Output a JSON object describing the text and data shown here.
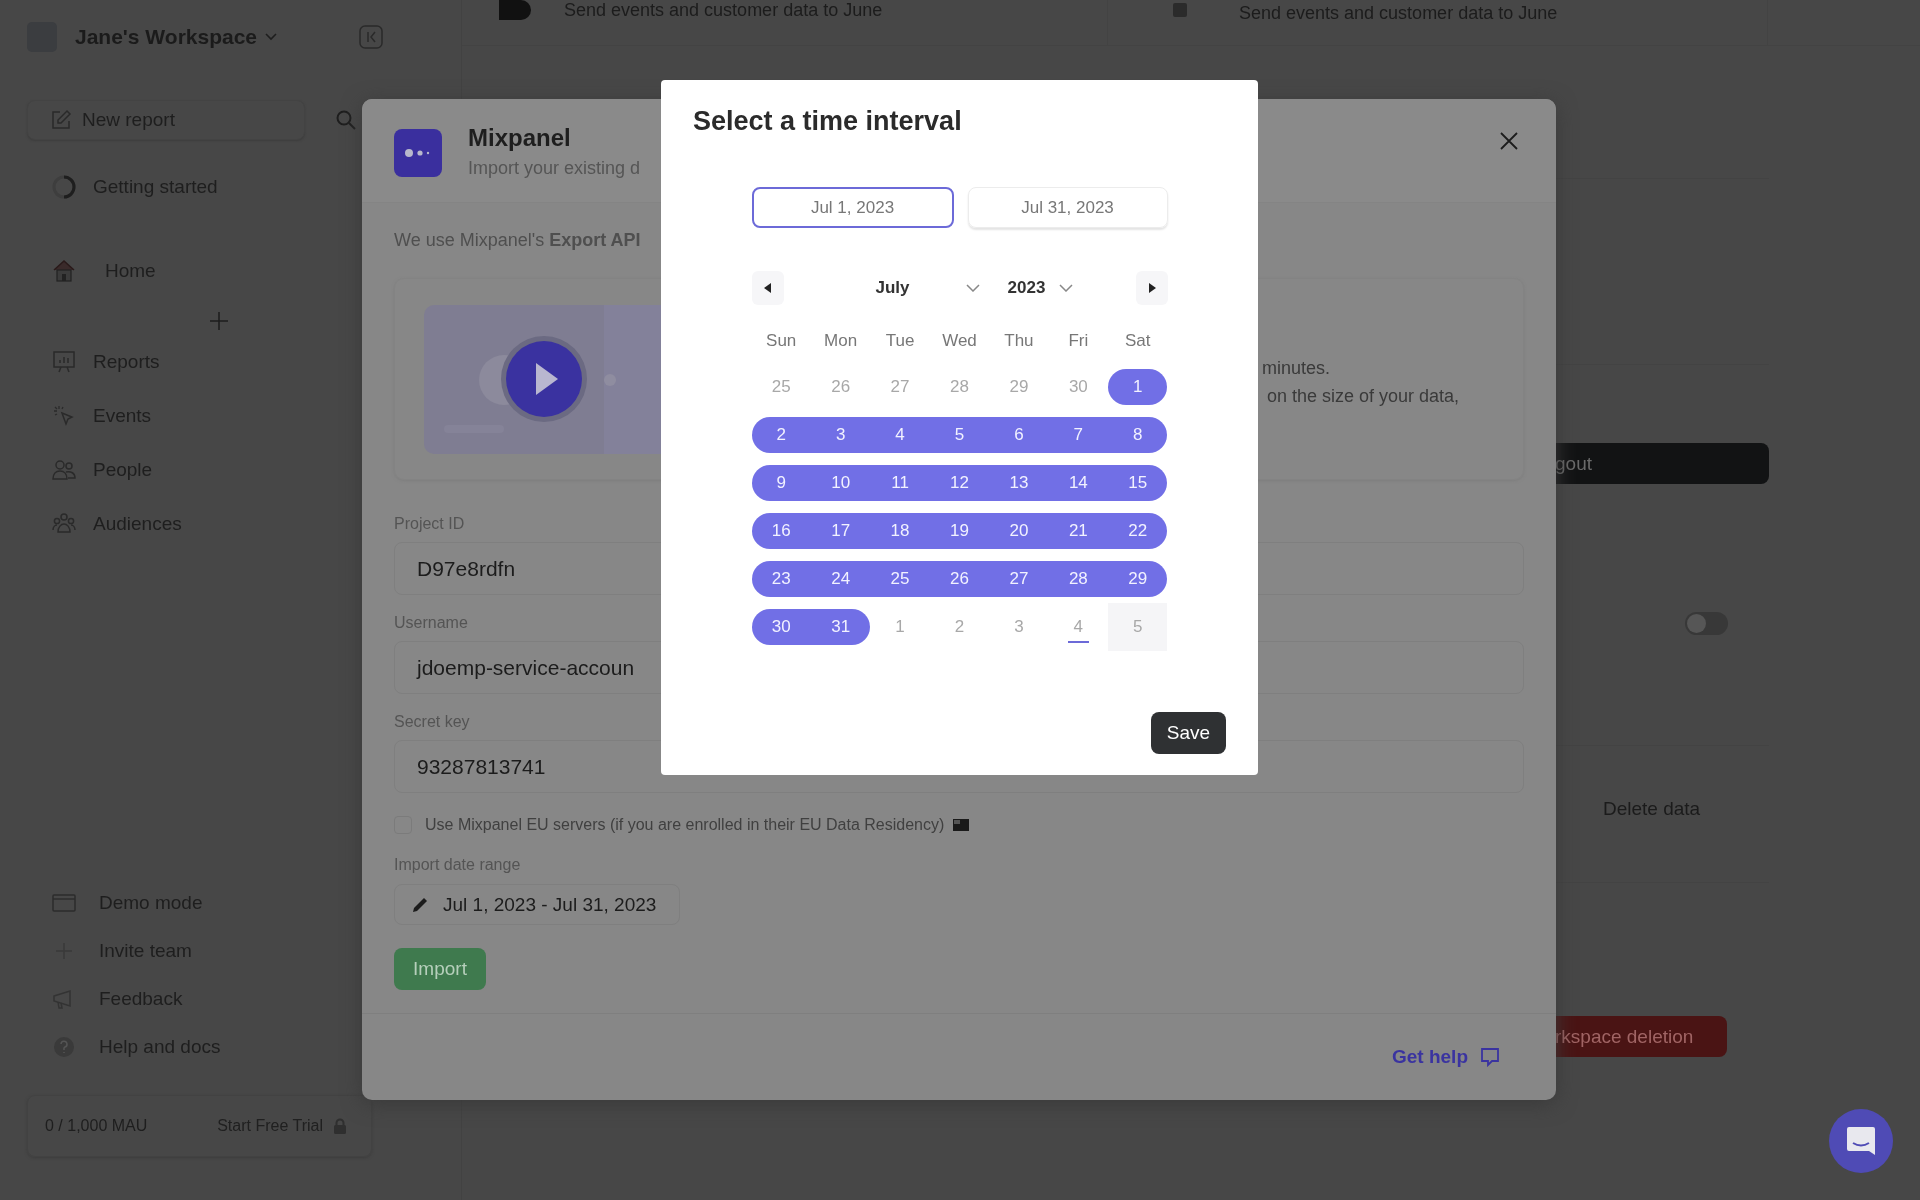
{
  "background": {
    "integrations": [
      "Send events and customer data to June",
      "Send events and customer data to June"
    ],
    "logout_button": "gout",
    "toggle": {
      "on": false
    },
    "delete_label": "Delete data",
    "delete_button": "rkspace deletion"
  },
  "sidebar": {
    "workspace": "Jane's Workspace",
    "new_report": "New report",
    "getting_started": "Getting started",
    "nav": [
      {
        "label": "Home"
      },
      {
        "label": "Reports"
      },
      {
        "label": "Events"
      },
      {
        "label": "People"
      },
      {
        "label": "Audiences"
      }
    ],
    "footer_items": [
      {
        "label": "Demo mode",
        "on": false
      },
      {
        "label": "Invite team"
      },
      {
        "label": "Feedback"
      },
      {
        "label": "Help and docs"
      }
    ],
    "usage": "0 / 1,000 MAU",
    "trial": "Start Free Trial"
  },
  "import_modal": {
    "title": "Mixpanel",
    "subtitle": "Import your existing d",
    "intro": "We use Mixpanel's **Export API**",
    "video_text": [
      "minutes.",
      "on the size of your data,"
    ],
    "fields": [
      {
        "label": "Project ID",
        "value": "D97e8rdfn"
      },
      {
        "label": "Username",
        "value": "jdoemp-service-accoun"
      },
      {
        "label": "Secret key",
        "value": "93287813741"
      }
    ],
    "eu_servers": {
      "label": "Use Mixpanel EU servers (if you are enrolled in their EU Data Residency)",
      "checked": false
    },
    "date_range_label": "Import date range",
    "date_range": "Jul 1, 2023 - Jul 31, 2023",
    "import_button": "Import",
    "help_link": "Get help"
  },
  "date_picker": {
    "title": "Select a time interval",
    "range_fields": [
      {
        "value": "Jul 1, 2023",
        "selected": true
      },
      {
        "value": "Jul 31, 2023",
        "selected": false
      }
    ],
    "month": "July",
    "year": "2023",
    "weekdays": [
      "Sun",
      "Mon",
      "Tue",
      "Wed",
      "Thu",
      "Fri",
      "Sat"
    ],
    "weeks": [
      [
        {
          "day": "25",
          "outside": true,
          "selected": false,
          "today": false,
          "hovered": false
        },
        {
          "day": "26",
          "outside": true,
          "selected": false,
          "today": false,
          "hovered": false
        },
        {
          "day": "27",
          "outside": true,
          "selected": false,
          "today": false,
          "hovered": false
        },
        {
          "day": "28",
          "outside": true,
          "selected": false,
          "today": false,
          "hovered": false
        },
        {
          "day": "29",
          "outside": true,
          "selected": false,
          "today": false,
          "hovered": false
        },
        {
          "day": "30",
          "outside": true,
          "selected": false,
          "today": false,
          "hovered": false
        },
        {
          "day": "1",
          "outside": false,
          "selected": true,
          "today": false,
          "hovered": false
        }
      ],
      [
        {
          "day": "2",
          "outside": false,
          "selected": true,
          "today": false,
          "hovered": false
        },
        {
          "day": "3",
          "outside": false,
          "selected": true,
          "today": false,
          "hovered": false
        },
        {
          "day": "4",
          "outside": false,
          "selected": true,
          "today": false,
          "hovered": false
        },
        {
          "day": "5",
          "outside": false,
          "selected": true,
          "today": false,
          "hovered": false
        },
        {
          "day": "6",
          "outside": false,
          "selected": true,
          "today": false,
          "hovered": false
        },
        {
          "day": "7",
          "outside": false,
          "selected": true,
          "today": false,
          "hovered": false
        },
        {
          "day": "8",
          "outside": false,
          "selected": true,
          "today": false,
          "hovered": false
        }
      ],
      [
        {
          "day": "9",
          "outside": false,
          "selected": true,
          "today": false,
          "hovered": false
        },
        {
          "day": "10",
          "outside": false,
          "selected": true,
          "today": false,
          "hovered": false
        },
        {
          "day": "11",
          "outside": false,
          "selected": true,
          "today": false,
          "hovered": false
        },
        {
          "day": "12",
          "outside": false,
          "selected": true,
          "today": false,
          "hovered": false
        },
        {
          "day": "13",
          "outside": false,
          "selected": true,
          "today": false,
          "hovered": false
        },
        {
          "day": "14",
          "outside": false,
          "selected": true,
          "today": false,
          "hovered": false
        },
        {
          "day": "15",
          "outside": false,
          "selected": true,
          "today": false,
          "hovered": false
        }
      ],
      [
        {
          "day": "16",
          "outside": false,
          "selected": true,
          "today": false,
          "hovered": false
        },
        {
          "day": "17",
          "outside": false,
          "selected": true,
          "today": false,
          "hovered": false
        },
        {
          "day": "18",
          "outside": false,
          "selected": true,
          "today": false,
          "hovered": false
        },
        {
          "day": "19",
          "outside": false,
          "selected": true,
          "today": false,
          "hovered": false
        },
        {
          "day": "20",
          "outside": false,
          "selected": true,
          "today": false,
          "hovered": false
        },
        {
          "day": "21",
          "outside": false,
          "selected": true,
          "today": false,
          "hovered": false
        },
        {
          "day": "22",
          "outside": false,
          "selected": true,
          "today": false,
          "hovered": false
        }
      ],
      [
        {
          "day": "23",
          "outside": false,
          "selected": true,
          "today": false,
          "hovered": false
        },
        {
          "day": "24",
          "outside": false,
          "selected": true,
          "today": false,
          "hovered": false
        },
        {
          "day": "25",
          "outside": false,
          "selected": true,
          "today": false,
          "hovered": false
        },
        {
          "day": "26",
          "outside": false,
          "selected": true,
          "today": false,
          "hovered": false
        },
        {
          "day": "27",
          "outside": false,
          "selected": true,
          "today": false,
          "hovered": false
        },
        {
          "day": "28",
          "outside": false,
          "selected": true,
          "today": false,
          "hovered": false
        },
        {
          "day": "29",
          "outside": false,
          "selected": true,
          "today": false,
          "hovered": false
        }
      ],
      [
        {
          "day": "30",
          "outside": false,
          "selected": true,
          "today": false,
          "hovered": false
        },
        {
          "day": "31",
          "outside": false,
          "selected": true,
          "today": false,
          "hovered": false
        },
        {
          "day": "1",
          "outside": true,
          "selected": false,
          "today": false,
          "hovered": false
        },
        {
          "day": "2",
          "outside": true,
          "selected": false,
          "today": false,
          "hovered": false
        },
        {
          "day": "3",
          "outside": true,
          "selected": false,
          "today": false,
          "hovered": false
        },
        {
          "day": "4",
          "outside": true,
          "selected": false,
          "today": true,
          "hovered": false
        },
        {
          "day": "5",
          "outside": true,
          "selected": false,
          "today": false,
          "hovered": true
        }
      ]
    ],
    "save_button": "Save"
  }
}
